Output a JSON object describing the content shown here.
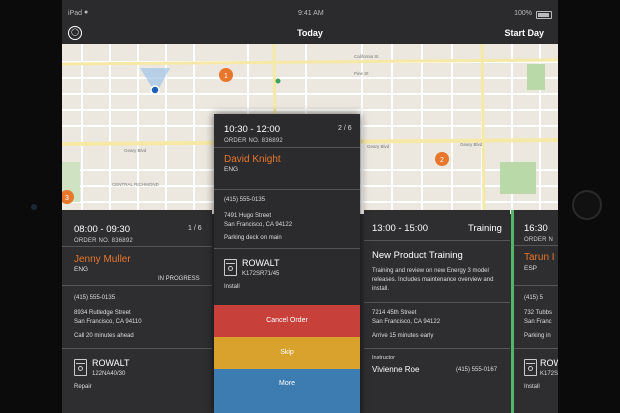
{
  "status_bar": {
    "carrier": "iPad",
    "time": "9:41 AM",
    "battery": "100%"
  },
  "nav": {
    "title": "Today",
    "start_label": "Start Day"
  },
  "map": {
    "street_labels": [
      "California St",
      "Pine St",
      "Geary Blvd",
      "Geary Blvd",
      "Geary Blvd",
      "CENTRAL RICHMOND"
    ],
    "markers": [
      "1",
      "2",
      "3"
    ]
  },
  "cards": {
    "left": {
      "time": "08:00 - 09:30",
      "count": "1 / 6",
      "order": "ORDER NO. 836892",
      "name": "Jenny Muller",
      "lang": "ENG",
      "status": "IN PROGRESS",
      "phone": "(415) 555-0135",
      "address1": "8934 Rutledge Street",
      "address2": "San Francisco, CA 94110",
      "note": "Call 20 minutes ahead",
      "product": "ROWALT",
      "model": "122NA40/30",
      "task": "Repair"
    },
    "popup": {
      "time": "10:30 - 12:00",
      "count": "2 / 6",
      "order": "ORDER NO. 836892",
      "name": "David Knight",
      "lang": "ENG",
      "phone": "(415) 555-0135",
      "address1": "7491 Hugo Street",
      "address2": "San Francisco, CA 94122",
      "note": "Parking deck on main",
      "product": "ROWALT",
      "model": "K172SR71/45",
      "task": "Install",
      "actions": [
        {
          "label": "Cancel Order",
          "color": "#c8403a"
        },
        {
          "label": "Skip",
          "color": "#d9a22d"
        },
        {
          "label": "More",
          "color": "#3c7cb0"
        }
      ]
    },
    "training": {
      "time": "13:00 - 15:00",
      "type": "Training",
      "title": "New Product Training",
      "desc": "Training and review on new Energy 3 model releases. Includes maintenance overview and install.",
      "address1": "7214 45th Street",
      "address2": "San Francisco, CA 94122",
      "note": "Arrive 15 minutes early",
      "instructor_label": "Instructor",
      "instructor": "Vivienne Roe",
      "phone": "(415) 555-0167"
    },
    "right": {
      "time": "16:30",
      "order": "ORDER N",
      "name": "Tarun I",
      "lang": "ESP",
      "phone": "(415) 5",
      "address1": "732 Tubbs",
      "address2": "San Franc",
      "note": "Parking in",
      "product": "ROW",
      "model": "K172S",
      "task": "Install"
    }
  },
  "colors": {
    "accent": "#e8762b",
    "panel": "#2e2e30",
    "training_accent": "#56b36a"
  }
}
